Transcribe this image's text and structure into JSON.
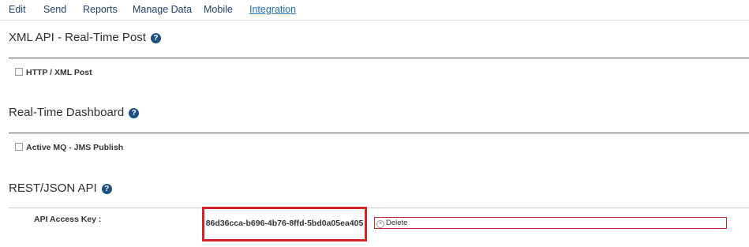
{
  "nav": {
    "items": [
      "Edit",
      "Send",
      "Reports",
      "Manage Data",
      "Mobile",
      "Integration"
    ],
    "active": "Integration"
  },
  "sections": {
    "xml": {
      "title": "XML API - Real-Time Post",
      "checkbox_label": "HTTP / XML Post",
      "checked": false
    },
    "dashboard": {
      "title": "Real-Time Dashboard",
      "checkbox_label": "Active MQ - JMS Publish",
      "checked": false
    },
    "rest": {
      "title": "REST/JSON API",
      "field_label": "API Access Key :",
      "api_key": "86d36cca-b696-4b76-8ffd-5bd0a05ea405",
      "delete_label": "Delete"
    }
  },
  "icons": {
    "help": "question-circle-icon",
    "delete": "x-circle-icon"
  },
  "colors": {
    "accent_blue": "#1c4f82",
    "highlight_red": "#d4222a"
  }
}
